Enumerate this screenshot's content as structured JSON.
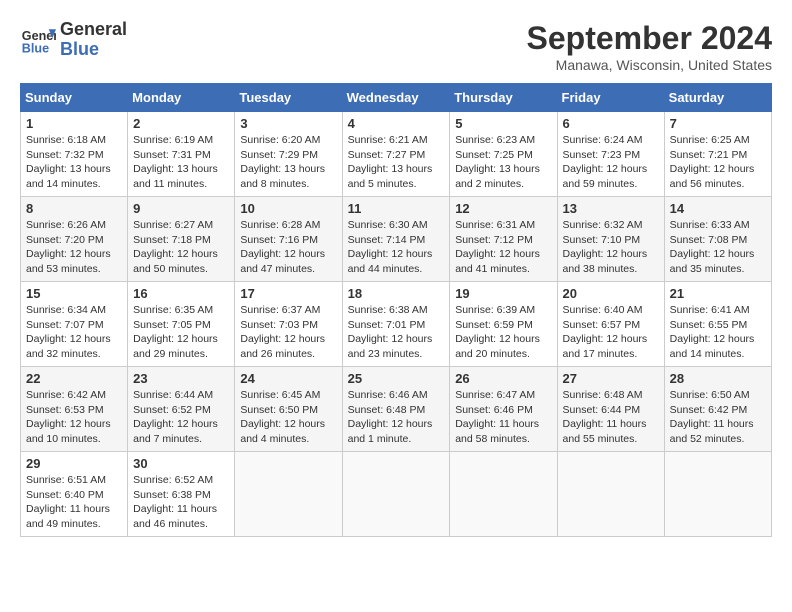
{
  "header": {
    "logo_line1": "General",
    "logo_line2": "Blue",
    "month": "September 2024",
    "location": "Manawa, Wisconsin, United States"
  },
  "weekdays": [
    "Sunday",
    "Monday",
    "Tuesday",
    "Wednesday",
    "Thursday",
    "Friday",
    "Saturday"
  ],
  "weeks": [
    [
      {
        "day": "1",
        "info": "Sunrise: 6:18 AM\nSunset: 7:32 PM\nDaylight: 13 hours\nand 14 minutes."
      },
      {
        "day": "2",
        "info": "Sunrise: 6:19 AM\nSunset: 7:31 PM\nDaylight: 13 hours\nand 11 minutes."
      },
      {
        "day": "3",
        "info": "Sunrise: 6:20 AM\nSunset: 7:29 PM\nDaylight: 13 hours\nand 8 minutes."
      },
      {
        "day": "4",
        "info": "Sunrise: 6:21 AM\nSunset: 7:27 PM\nDaylight: 13 hours\nand 5 minutes."
      },
      {
        "day": "5",
        "info": "Sunrise: 6:23 AM\nSunset: 7:25 PM\nDaylight: 13 hours\nand 2 minutes."
      },
      {
        "day": "6",
        "info": "Sunrise: 6:24 AM\nSunset: 7:23 PM\nDaylight: 12 hours\nand 59 minutes."
      },
      {
        "day": "7",
        "info": "Sunrise: 6:25 AM\nSunset: 7:21 PM\nDaylight: 12 hours\nand 56 minutes."
      }
    ],
    [
      {
        "day": "8",
        "info": "Sunrise: 6:26 AM\nSunset: 7:20 PM\nDaylight: 12 hours\nand 53 minutes."
      },
      {
        "day": "9",
        "info": "Sunrise: 6:27 AM\nSunset: 7:18 PM\nDaylight: 12 hours\nand 50 minutes."
      },
      {
        "day": "10",
        "info": "Sunrise: 6:28 AM\nSunset: 7:16 PM\nDaylight: 12 hours\nand 47 minutes."
      },
      {
        "day": "11",
        "info": "Sunrise: 6:30 AM\nSunset: 7:14 PM\nDaylight: 12 hours\nand 44 minutes."
      },
      {
        "day": "12",
        "info": "Sunrise: 6:31 AM\nSunset: 7:12 PM\nDaylight: 12 hours\nand 41 minutes."
      },
      {
        "day": "13",
        "info": "Sunrise: 6:32 AM\nSunset: 7:10 PM\nDaylight: 12 hours\nand 38 minutes."
      },
      {
        "day": "14",
        "info": "Sunrise: 6:33 AM\nSunset: 7:08 PM\nDaylight: 12 hours\nand 35 minutes."
      }
    ],
    [
      {
        "day": "15",
        "info": "Sunrise: 6:34 AM\nSunset: 7:07 PM\nDaylight: 12 hours\nand 32 minutes."
      },
      {
        "day": "16",
        "info": "Sunrise: 6:35 AM\nSunset: 7:05 PM\nDaylight: 12 hours\nand 29 minutes."
      },
      {
        "day": "17",
        "info": "Sunrise: 6:37 AM\nSunset: 7:03 PM\nDaylight: 12 hours\nand 26 minutes."
      },
      {
        "day": "18",
        "info": "Sunrise: 6:38 AM\nSunset: 7:01 PM\nDaylight: 12 hours\nand 23 minutes."
      },
      {
        "day": "19",
        "info": "Sunrise: 6:39 AM\nSunset: 6:59 PM\nDaylight: 12 hours\nand 20 minutes."
      },
      {
        "day": "20",
        "info": "Sunrise: 6:40 AM\nSunset: 6:57 PM\nDaylight: 12 hours\nand 17 minutes."
      },
      {
        "day": "21",
        "info": "Sunrise: 6:41 AM\nSunset: 6:55 PM\nDaylight: 12 hours\nand 14 minutes."
      }
    ],
    [
      {
        "day": "22",
        "info": "Sunrise: 6:42 AM\nSunset: 6:53 PM\nDaylight: 12 hours\nand 10 minutes."
      },
      {
        "day": "23",
        "info": "Sunrise: 6:44 AM\nSunset: 6:52 PM\nDaylight: 12 hours\nand 7 minutes."
      },
      {
        "day": "24",
        "info": "Sunrise: 6:45 AM\nSunset: 6:50 PM\nDaylight: 12 hours\nand 4 minutes."
      },
      {
        "day": "25",
        "info": "Sunrise: 6:46 AM\nSunset: 6:48 PM\nDaylight: 12 hours\nand 1 minute."
      },
      {
        "day": "26",
        "info": "Sunrise: 6:47 AM\nSunset: 6:46 PM\nDaylight: 11 hours\nand 58 minutes."
      },
      {
        "day": "27",
        "info": "Sunrise: 6:48 AM\nSunset: 6:44 PM\nDaylight: 11 hours\nand 55 minutes."
      },
      {
        "day": "28",
        "info": "Sunrise: 6:50 AM\nSunset: 6:42 PM\nDaylight: 11 hours\nand 52 minutes."
      }
    ],
    [
      {
        "day": "29",
        "info": "Sunrise: 6:51 AM\nSunset: 6:40 PM\nDaylight: 11 hours\nand 49 minutes."
      },
      {
        "day": "30",
        "info": "Sunrise: 6:52 AM\nSunset: 6:38 PM\nDaylight: 11 hours\nand 46 minutes."
      },
      {
        "day": "",
        "info": ""
      },
      {
        "day": "",
        "info": ""
      },
      {
        "day": "",
        "info": ""
      },
      {
        "day": "",
        "info": ""
      },
      {
        "day": "",
        "info": ""
      }
    ]
  ]
}
